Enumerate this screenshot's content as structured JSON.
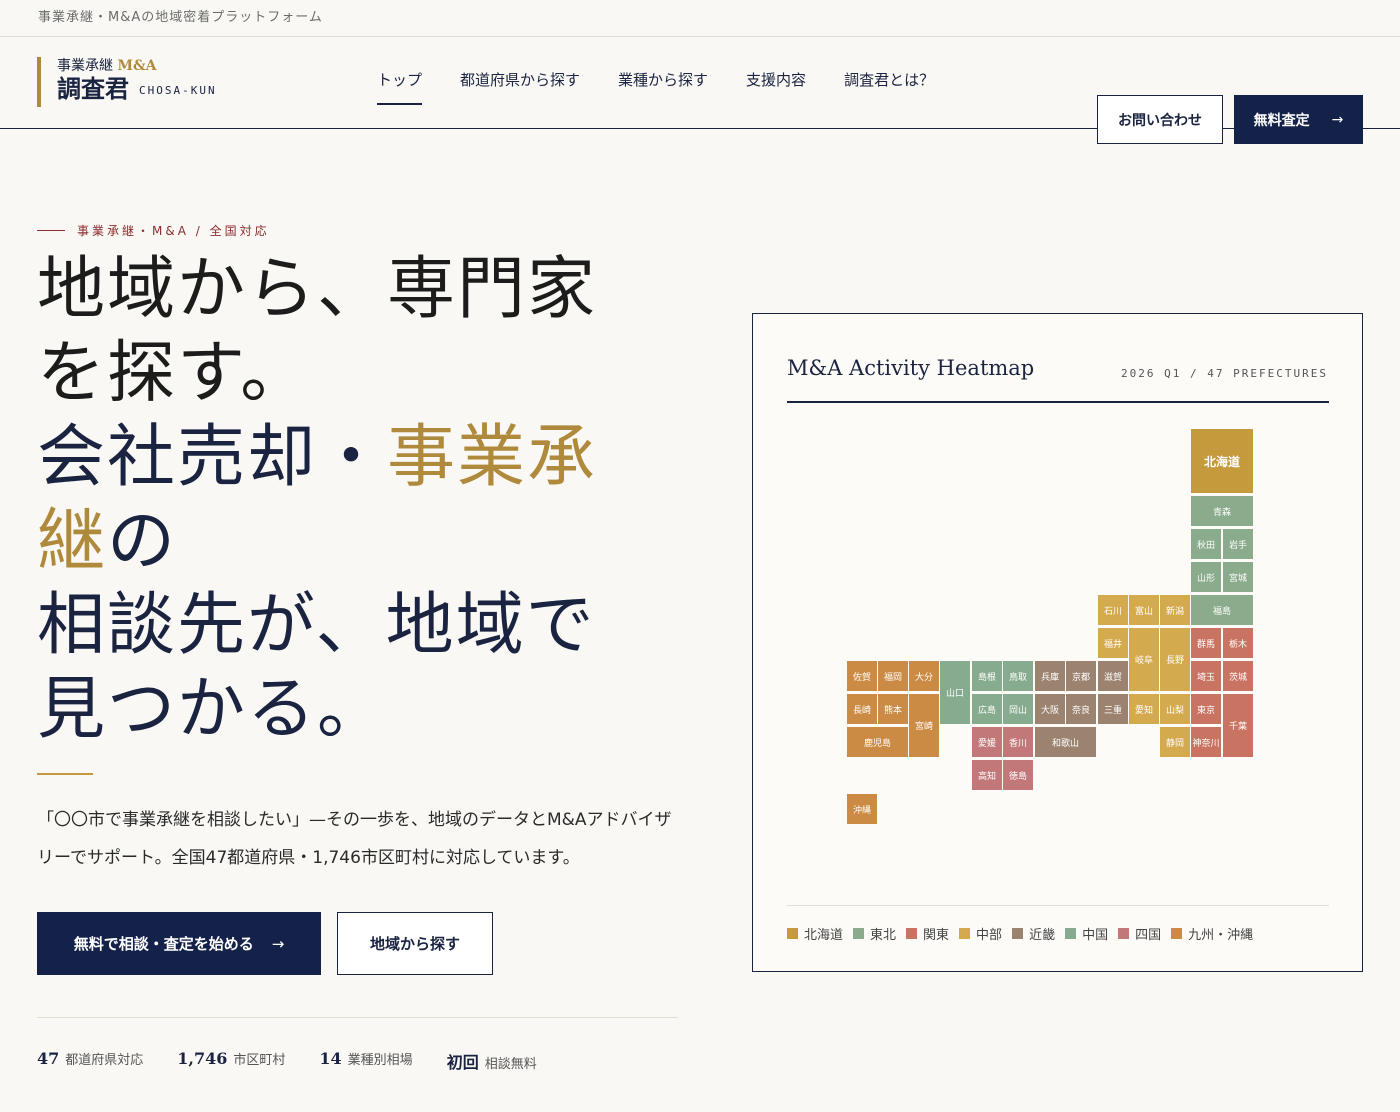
{
  "topbar": {
    "text": "事業承継・M&Aの地域密着プラットフォーム"
  },
  "logo": {
    "top_prefix": "事業承継",
    "top_accent": "M&A",
    "main": "調査君",
    "roman": "CHOSA-KUN"
  },
  "nav": {
    "items": [
      {
        "label": "トップ",
        "active": true
      },
      {
        "label": "都道府県から探す",
        "active": false
      },
      {
        "label": "業種から探す",
        "active": false
      },
      {
        "label": "支援内容",
        "active": false
      },
      {
        "label": "調査君とは？",
        "active": false
      }
    ]
  },
  "header_buttons": {
    "contact": "お問い合わせ",
    "assess": "無料査定",
    "assess_arrow": "→"
  },
  "hero": {
    "eyebrow": "事業承継・M&A / 全国対応",
    "headline_1": "地域から、専門家を探す。",
    "headline_2a": "会社売却・",
    "headline_2b": "事業承継",
    "headline_2c": "の",
    "headline_3": "相談先が、地域で見つかる。",
    "lead": "「〇〇市で事業承継を相談したい」—その一歩を、地域のデータとM&Aアドバイザリーでサポート。全国47都道府県・1,746市区町村に対応しています。",
    "cta_primary": "無料で相談・査定を始める",
    "cta_primary_arrow": "→",
    "cta_secondary": "地域から探す"
  },
  "stats": [
    {
      "num": "47",
      "label": "都道府県対応"
    },
    {
      "num": "1,746",
      "label": "市区町村"
    },
    {
      "num": "14",
      "label": "業種別相場"
    },
    {
      "num": "初回",
      "label": "相談無料"
    }
  ],
  "heatmap": {
    "title": "M&A Activity Heatmap",
    "meta": "2026 Q1 / 47 PREFECTURES",
    "colors": {
      "hokkaido": "#c49a3c",
      "tohoku": "#8aab8c",
      "kanto": "#c97462",
      "chubu": "#d4aa4e",
      "kinki": "#9c8370",
      "chugoku": "#86ab8e",
      "shikoku": "#c27878",
      "kyushu": "#cb8b45"
    },
    "legend": [
      {
        "label": "北海道",
        "region": "hokkaido"
      },
      {
        "label": "東北",
        "region": "tohoku"
      },
      {
        "label": "関東",
        "region": "kanto"
      },
      {
        "label": "中部",
        "region": "chubu"
      },
      {
        "label": "近畿",
        "region": "kinki"
      },
      {
        "label": "中国",
        "region": "chugoku"
      },
      {
        "label": "四国",
        "region": "shikoku"
      },
      {
        "label": "九州・沖縄",
        "region": "kyushu"
      }
    ],
    "prefectures": [
      {
        "name": "北海道",
        "region": "hokkaido"
      },
      {
        "name": "青森",
        "region": "tohoku"
      },
      {
        "name": "秋田",
        "region": "tohoku"
      },
      {
        "name": "岩手",
        "region": "tohoku"
      },
      {
        "name": "山形",
        "region": "tohoku"
      },
      {
        "name": "宮城",
        "region": "tohoku"
      },
      {
        "name": "福島",
        "region": "tohoku"
      },
      {
        "name": "石川",
        "region": "chubu"
      },
      {
        "name": "富山",
        "region": "chubu"
      },
      {
        "name": "新潟",
        "region": "chubu"
      },
      {
        "name": "福井",
        "region": "chubu"
      },
      {
        "name": "岐阜",
        "region": "chubu"
      },
      {
        "name": "長野",
        "region": "chubu"
      },
      {
        "name": "群馬",
        "region": "kanto"
      },
      {
        "name": "栃木",
        "region": "kanto"
      },
      {
        "name": "佐賀",
        "region": "kyushu"
      },
      {
        "name": "福岡",
        "region": "kyushu"
      },
      {
        "name": "大分",
        "region": "kyushu"
      },
      {
        "name": "山口",
        "region": "chugoku"
      },
      {
        "name": "島根",
        "region": "chugoku"
      },
      {
        "name": "鳥取",
        "region": "chugoku"
      },
      {
        "name": "兵庫",
        "region": "kinki"
      },
      {
        "name": "京都",
        "region": "kinki"
      },
      {
        "name": "滋賀",
        "region": "kinki"
      },
      {
        "name": "埼玉",
        "region": "kanto"
      },
      {
        "name": "茨城",
        "region": "kanto"
      },
      {
        "name": "長崎",
        "region": "kyushu"
      },
      {
        "name": "熊本",
        "region": "kyushu"
      },
      {
        "name": "宮崎",
        "region": "kyushu"
      },
      {
        "name": "広島",
        "region": "chugoku"
      },
      {
        "name": "岡山",
        "region": "chugoku"
      },
      {
        "name": "大阪",
        "region": "kinki"
      },
      {
        "name": "奈良",
        "region": "kinki"
      },
      {
        "name": "三重",
        "region": "kinki"
      },
      {
        "name": "愛知",
        "region": "chubu"
      },
      {
        "name": "山梨",
        "region": "chubu"
      },
      {
        "name": "東京",
        "region": "kanto"
      },
      {
        "name": "千葉",
        "region": "kanto"
      },
      {
        "name": "鹿児島",
        "region": "kyushu"
      },
      {
        "name": "愛媛",
        "region": "shikoku"
      },
      {
        "name": "香川",
        "region": "shikoku"
      },
      {
        "name": "和歌山",
        "region": "kinki"
      },
      {
        "name": "静岡",
        "region": "chubu"
      },
      {
        "name": "神奈川",
        "region": "kanto"
      },
      {
        "name": "高知",
        "region": "shikoku"
      },
      {
        "name": "徳島",
        "region": "shikoku"
      },
      {
        "name": "沖縄",
        "region": "kyushu"
      }
    ]
  }
}
